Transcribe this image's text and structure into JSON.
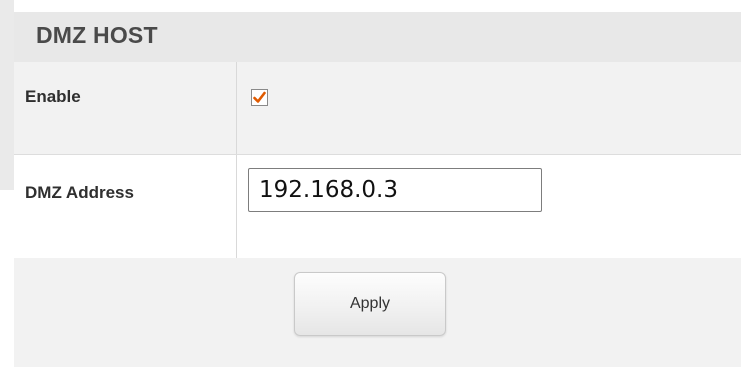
{
  "section": {
    "title": "DMZ HOST"
  },
  "form": {
    "enable": {
      "label": "Enable",
      "checked": true,
      "check_color": "#e05a00"
    },
    "dmz_address": {
      "label": "DMZ Address",
      "value": "192.168.0.3"
    }
  },
  "actions": {
    "apply_label": "Apply"
  }
}
